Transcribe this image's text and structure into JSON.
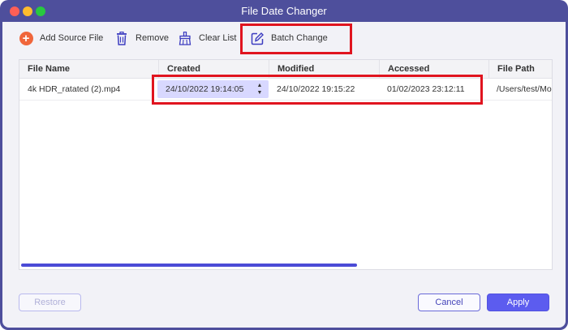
{
  "window": {
    "title": "File Date Changer"
  },
  "toolbar": {
    "add_source": "Add Source File",
    "remove": "Remove",
    "clear_list": "Clear List",
    "batch_change": "Batch Change"
  },
  "table": {
    "columns": [
      "File Name",
      "Created",
      "Modified",
      "Accessed",
      "File Path"
    ],
    "rows": [
      {
        "file_name": "4k HDR_ratated (2).mp4",
        "created": "24/10/2022 19:14:05",
        "modified": "24/10/2022 19:15:22",
        "accessed": "01/02/2023 23:12:11",
        "file_path": "/Users/test/Mo"
      }
    ]
  },
  "footer": {
    "restore": "Restore",
    "cancel": "Cancel",
    "apply": "Apply"
  },
  "colors": {
    "titlebar": "#4e4f9c",
    "accent": "#5c5cef",
    "highlight": "#e0141f",
    "add_icon": "#f0663b"
  },
  "icons": {
    "add": "plus-circle-icon",
    "remove": "trash-icon",
    "clear_list": "broom-icon",
    "batch_change": "edit-icon",
    "stepper": "stepper-icon"
  }
}
